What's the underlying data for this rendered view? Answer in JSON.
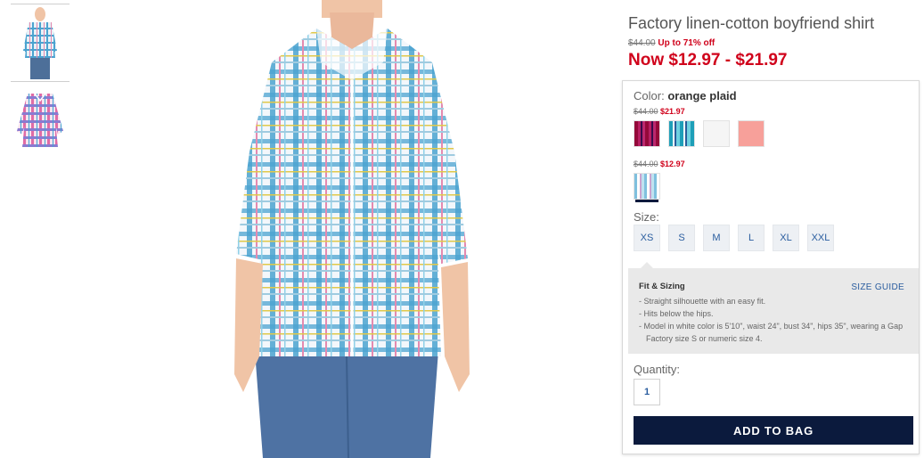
{
  "product": {
    "title": "Factory linen-cotton boyfriend shirt",
    "original_price": "$44.00",
    "discount_text": "Up to 71% off",
    "now_price": "Now $12.97 - $21.97"
  },
  "color": {
    "label": "Color:",
    "selected": "orange plaid",
    "groups": [
      {
        "original_price": "$44.00",
        "sale_price": "$21.97",
        "swatches": [
          "pink plaid",
          "turquoise plaid",
          "white",
          "coral"
        ]
      },
      {
        "original_price": "$44.00",
        "sale_price": "$12.97",
        "swatches": [
          "orange plaid"
        ]
      }
    ]
  },
  "size": {
    "label": "Size:",
    "options": [
      "XS",
      "S",
      "M",
      "L",
      "XL",
      "XXL"
    ]
  },
  "fit": {
    "heading": "Fit & Sizing",
    "size_guide": "SIZE GUIDE",
    "bullets": [
      "- Straight silhouette with an easy fit.",
      "- Hits below the hips.",
      "- Model in white color is 5'10\", waist 24\", bust 34\", hips 35\", wearing a Gap Factory size S or numeric size 4."
    ]
  },
  "quantity": {
    "label": "Quantity:",
    "value": "1"
  },
  "add_to_bag": "ADD TO BAG",
  "colors": {
    "sale_red": "#d0021b",
    "navy": "#0b1a3d",
    "link_blue": "#2a5d9f"
  }
}
